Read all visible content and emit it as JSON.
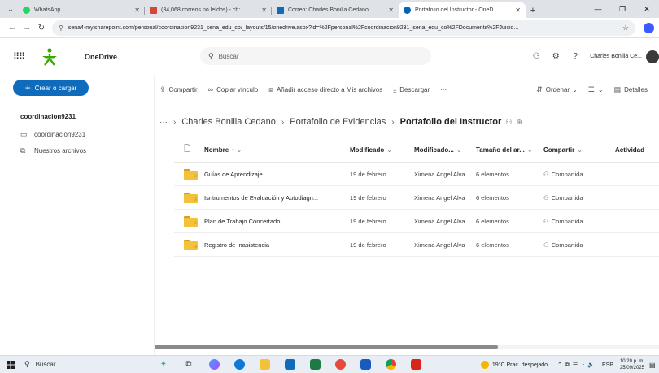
{
  "browser": {
    "tabs": [
      {
        "title": "WhatsApp",
        "favicon_color": "#25d366",
        "active": false
      },
      {
        "title": "(34,068 correos no leídos) - ch:",
        "favicon_color": "#d44638",
        "active": false
      },
      {
        "title": "Correo: Charles Bonilla Cedano",
        "favicon_color": "#0f6cbd",
        "active": false
      },
      {
        "title": "Portafolio del Instructor - OneD",
        "favicon_color": "#0364b8",
        "active": true
      }
    ],
    "url": "sena4-my.sharepoint.com/personal/coordinacion9231_sena_edu_co/_layouts/15/onedrive.aspx?id=%2Fpersonal%2Fcoordinacion9231_sena_edu_co%2FDocuments%2FJuicio..."
  },
  "header": {
    "app_name": "OneDrive",
    "search_placeholder": "Buscar",
    "user_name": "Charles Bonilla Ce..."
  },
  "sidebar": {
    "create_label": "Crear o cargar",
    "account_heading": "coordinacion9231",
    "items": [
      {
        "label": "coordinacion9231",
        "icon": "folder-icon"
      },
      {
        "label": "Nuestros archivos",
        "icon": "shared-files-icon"
      }
    ]
  },
  "commands": {
    "share": "Compartir",
    "copy_link": "Copiar vínculo",
    "add_shortcut": "Añadir acceso directo a Mis archivos",
    "download": "Descargar",
    "more": "···",
    "sort": "Ordenar",
    "view": "",
    "details": "Detalles"
  },
  "breadcrumb": {
    "items": [
      "Charles Bonilla Cedano",
      "Portafolio de Evidencias"
    ],
    "current": "Portafolio del Instructor"
  },
  "table": {
    "columns": {
      "name": "Nombre",
      "modified": "Modificado",
      "modified_by": "Modificado...",
      "size": "Tamaño del ar...",
      "sharing": "Compartir",
      "activity": "Actividad"
    },
    "rows": [
      {
        "name": "Guías de Aprendizaje",
        "modified": "19 de febrero",
        "modified_by": "Ximena Angel Alva",
        "size": "6 elementos",
        "sharing": "Compartida"
      },
      {
        "name": "Isntrumentos de Evaluación y Autodiagn...",
        "modified": "19 de febrero",
        "modified_by": "Ximena Angel Alva",
        "size": "6 elementos",
        "sharing": "Compartida"
      },
      {
        "name": "Plan de Trabajo Concertado",
        "modified": "19 de febrero",
        "modified_by": "Ximena Angel Alva",
        "size": "6 elementos",
        "sharing": "Compartida"
      },
      {
        "name": "Registro de Inasistencia",
        "modified": "19 de febrero",
        "modified_by": "Ximena Angel Alva",
        "size": "6 elementos",
        "sharing": "Compartida"
      }
    ]
  },
  "taskbar": {
    "search_label": "Buscar",
    "weather": "19°C  Prac. despejado",
    "language": "ESP",
    "time": "10:20 p. m.",
    "date": "25/09/2025"
  },
  "colors": {
    "accent": "#0f6cbd",
    "folder": "#f4c23a",
    "sena_green": "#39a900"
  }
}
